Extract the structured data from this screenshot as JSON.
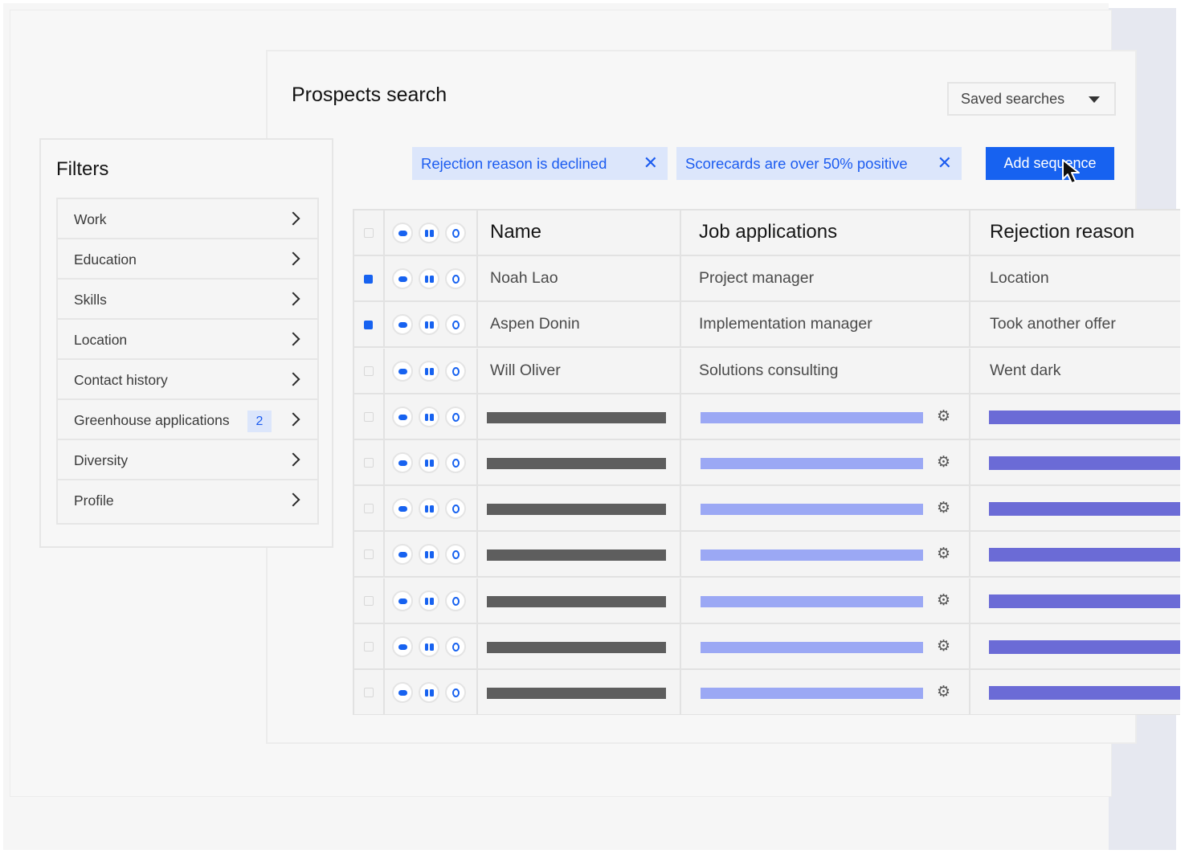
{
  "page": {
    "title": "Prospects search"
  },
  "saved_searches": {
    "label": "Saved searches"
  },
  "filter_chips": [
    {
      "label": "Rejection reason is declined",
      "remove_icon": "close-icon"
    },
    {
      "label": "Scorecards are over 50% positive",
      "remove_icon": "close-icon"
    }
  ],
  "add_sequence": {
    "label": "Add sequence"
  },
  "table": {
    "headers": {
      "name": "Name",
      "job_applications": "Job applications",
      "rejection_reason": "Rejection reason"
    },
    "rows": [
      {
        "selected": true,
        "name": "Noah Lao",
        "job": "Project manager",
        "reason": "Location"
      },
      {
        "selected": true,
        "name": "Aspen Donin",
        "job": "Implementation manager",
        "reason": "Took another offer"
      },
      {
        "selected": false,
        "name": "Will Oliver",
        "job": "Solutions consulting",
        "reason": "Went dark"
      }
    ],
    "placeholder_rows": 7
  },
  "filters": {
    "title": "Filters",
    "items": [
      {
        "label": "Work"
      },
      {
        "label": "Education"
      },
      {
        "label": "Skills"
      },
      {
        "label": "Location"
      },
      {
        "label": "Contact history"
      },
      {
        "label": "Greenhouse applications",
        "badge": "2"
      },
      {
        "label": "Diversity"
      },
      {
        "label": "Profile"
      }
    ]
  },
  "colors": {
    "accent": "#1762f0",
    "chip_bg": "#dce6fb",
    "bar_dark": "#5e5e5e",
    "bar_light": "#9ba8f4",
    "bar_purple": "#6b6bd6"
  }
}
